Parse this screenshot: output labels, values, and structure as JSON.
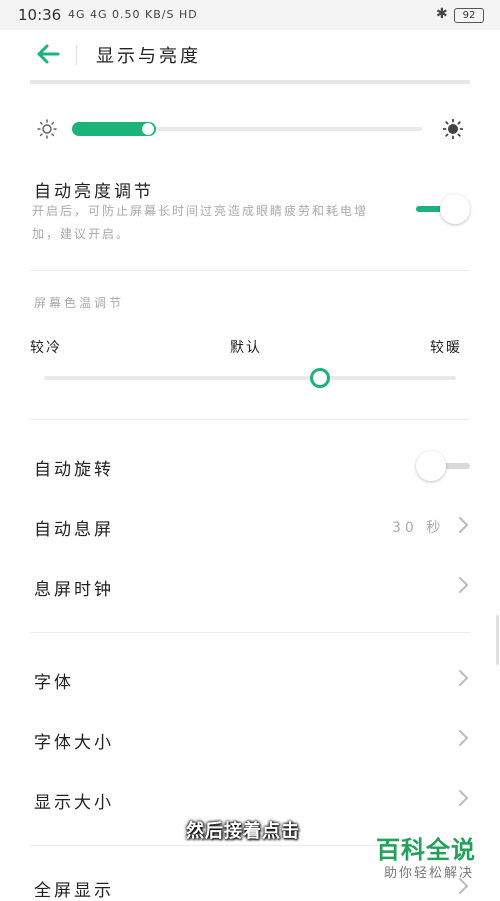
{
  "status_bar": {
    "time": "10:36",
    "network": "4G 4G 0.50 KB/S HD",
    "battery": "92"
  },
  "header": {
    "title": "显示与亮度"
  },
  "brightness": {
    "level": 0.24,
    "accent": "#1bb37a"
  },
  "auto_brightness": {
    "title": "自动亮度调节",
    "description": "开启后，可防止屏幕长时间过亮造成眼睛疲劳和耗电增加，建议开启。",
    "enabled": true
  },
  "color_temp": {
    "section_label": "屏幕色温调节",
    "cool_label": "较冷",
    "default_label": "默认",
    "warm_label": "较暖",
    "level": 0.67
  },
  "settings": {
    "auto_rotate": {
      "title": "自动旋转",
      "enabled": false
    },
    "auto_sleep": {
      "title": "自动息屏",
      "value": "30 秒"
    },
    "sleep_clock": {
      "title": "息屏时钟"
    },
    "font": {
      "title": "字体"
    },
    "font_size": {
      "title": "字体大小"
    },
    "display_size": {
      "title": "显示大小"
    },
    "fullscreen": {
      "title": "全屏显示"
    }
  },
  "caption": "然后接着点击",
  "watermark": {
    "main": "百科全说",
    "sub": "助你轻松解决"
  }
}
